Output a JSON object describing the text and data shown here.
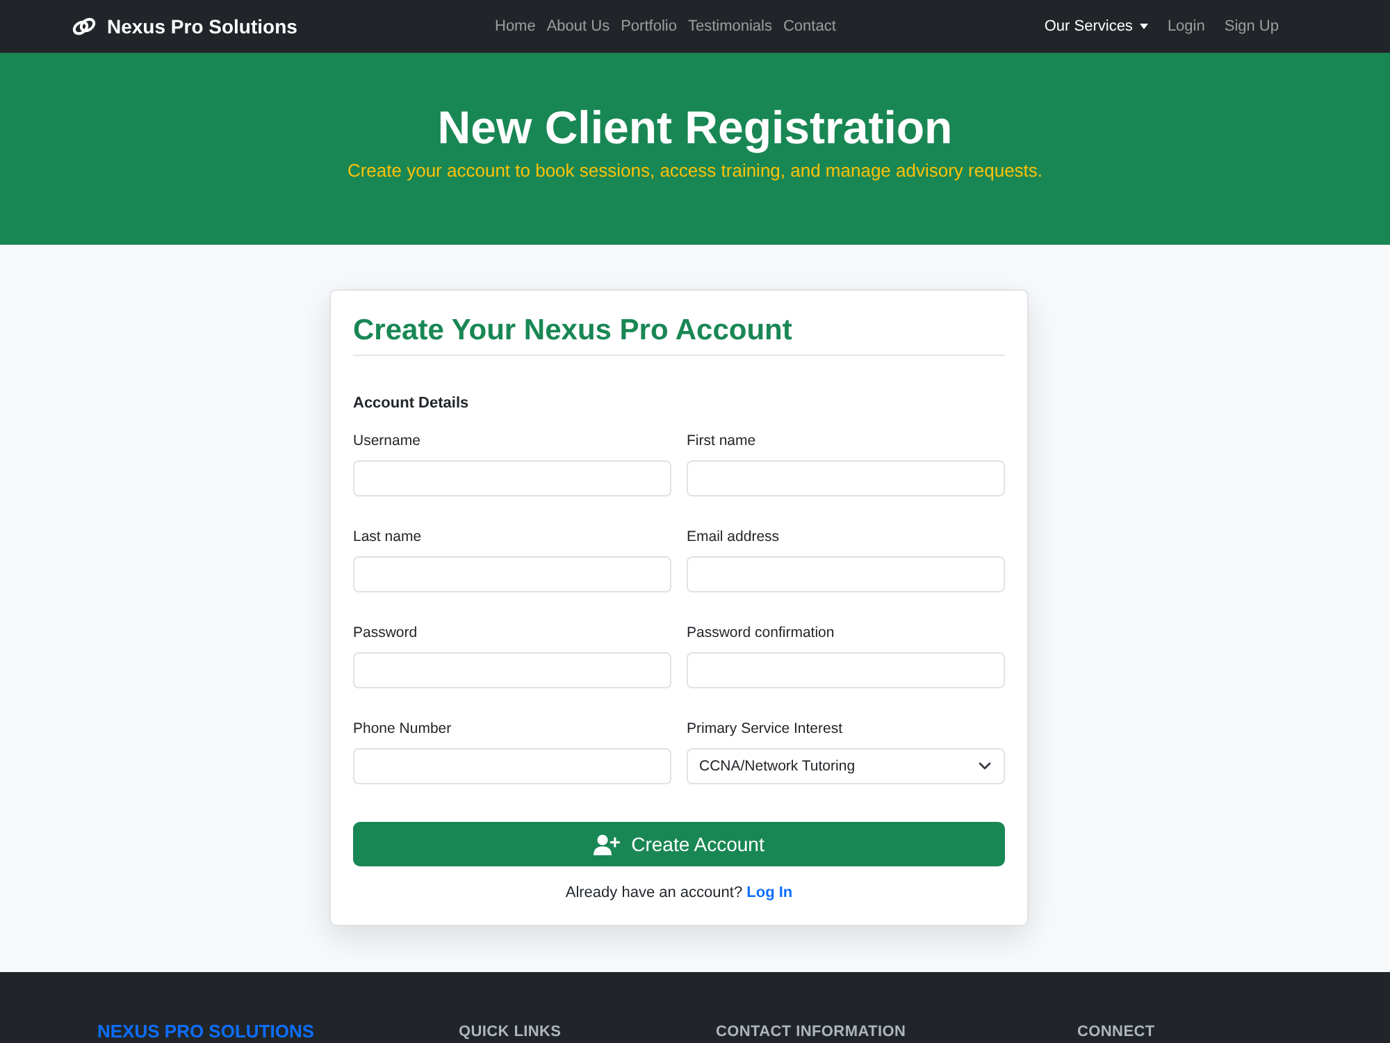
{
  "navbar": {
    "brand": "Nexus Pro Solutions",
    "links": [
      {
        "label": "Home"
      },
      {
        "label": "About Us"
      },
      {
        "label": "Portfolio"
      },
      {
        "label": "Testimonials"
      },
      {
        "label": "Contact"
      }
    ],
    "right_links": [
      {
        "label": "Our Services",
        "kind": "dropdown"
      },
      {
        "label": "Login",
        "kind": "link"
      },
      {
        "label": "Sign Up",
        "kind": "link"
      }
    ]
  },
  "hero": {
    "title": "New Client Registration",
    "subtitle": "Create your account to book sessions, access training, and manage advisory requests."
  },
  "card": {
    "title": "Create Your Nexus Pro Account",
    "section": "Account Details",
    "fields": [
      {
        "label": "Username",
        "kind": "text"
      },
      {
        "label": "First name",
        "kind": "text"
      },
      {
        "label": "Last name",
        "kind": "text"
      },
      {
        "label": "Email address",
        "kind": "text"
      },
      {
        "label": "Password",
        "kind": "text"
      },
      {
        "label": "Password confirmation",
        "kind": "text"
      },
      {
        "label": "Phone Number",
        "kind": "text"
      },
      {
        "label": "Primary Service Interest",
        "kind": "select",
        "value": "CCNA/Network Tutoring"
      }
    ],
    "submit": "Create Account",
    "login_prompt": "Already have an account?",
    "login_link": "Log In"
  },
  "footer": {
    "headings": [
      {
        "label": "NEXUS PRO SOLUTIONS",
        "kind": "brand"
      },
      {
        "label": "QUICK LINKS",
        "kind": "section"
      },
      {
        "label": "CONTACT INFORMATION",
        "kind": "section"
      },
      {
        "label": "CONNECT",
        "kind": "section"
      }
    ]
  }
}
